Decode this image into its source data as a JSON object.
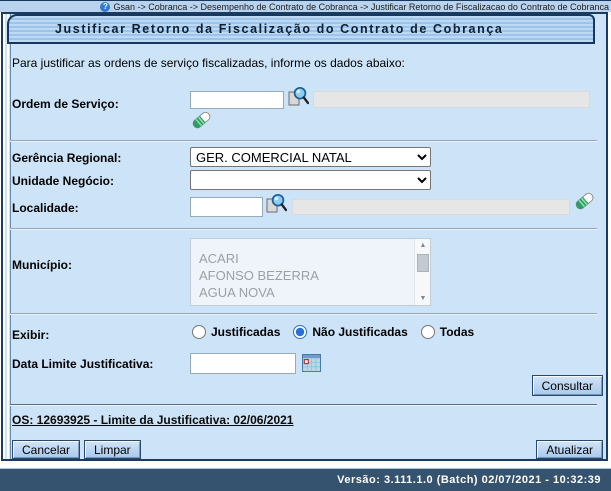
{
  "breadcrumb": {
    "text": "Gsan -> Cobranca -> Desempenho de Contrato de Cobranca -> Justificar Retorno de Fiscalizacao do Contrato de Cobranca",
    "help_icon": "question-circle"
  },
  "page": {
    "title": "Justificar Retorno da Fiscalização do Contrato de Cobrança",
    "intro": "Para justificar as ordens de serviço fiscalizadas, informe os dados abaixo:"
  },
  "form": {
    "ordem_servico": {
      "label": "Ordem de Serviço:",
      "value": "",
      "descricao": ""
    },
    "gerencia_regional": {
      "label": "Gerência Regional:",
      "value": "GER. COMERCIAL NATAL"
    },
    "unidade_negocio": {
      "label": "Unidade Negócio:",
      "value": ""
    },
    "localidade": {
      "label": "Localidade:",
      "value": "",
      "descricao": ""
    },
    "municipio": {
      "label": "Município:",
      "options": [
        "ACARI",
        "AFONSO BEZERRA",
        "AGUA NOVA"
      ]
    },
    "exibir": {
      "label": "Exibir:",
      "options": [
        {
          "label": "Justificadas"
        },
        {
          "label": "Não Justificadas",
          "checked": "checked"
        },
        {
          "label": "Todas"
        }
      ]
    },
    "data_limite": {
      "label": "Data Limite Justificativa:",
      "value": ""
    }
  },
  "icons": {
    "search": "magnifier-document",
    "erase": "eraser",
    "calendar": "calendar-grid"
  },
  "actions": {
    "consultar": "Consultar",
    "cancelar": "Cancelar",
    "limpar": "Limpar",
    "atualizar": "Atualizar"
  },
  "result_link": {
    "text": "OS: 12693925 - Limite da Justificativa: 02/06/2021"
  },
  "footer": {
    "version_text": "Versão: 3.111.1.0 (Batch) 02/07/2021 - 10:32:39"
  },
  "colors": {
    "accent": "#2970d6",
    "panel_bg": "#cde3f7",
    "breadcrumb_bg": "#b9d3ef",
    "footer_bg": "#35536e",
    "tab_border": "#17375c",
    "disabled_text": "#9aa0a6",
    "readonly_bg": "#e6e6e6"
  }
}
